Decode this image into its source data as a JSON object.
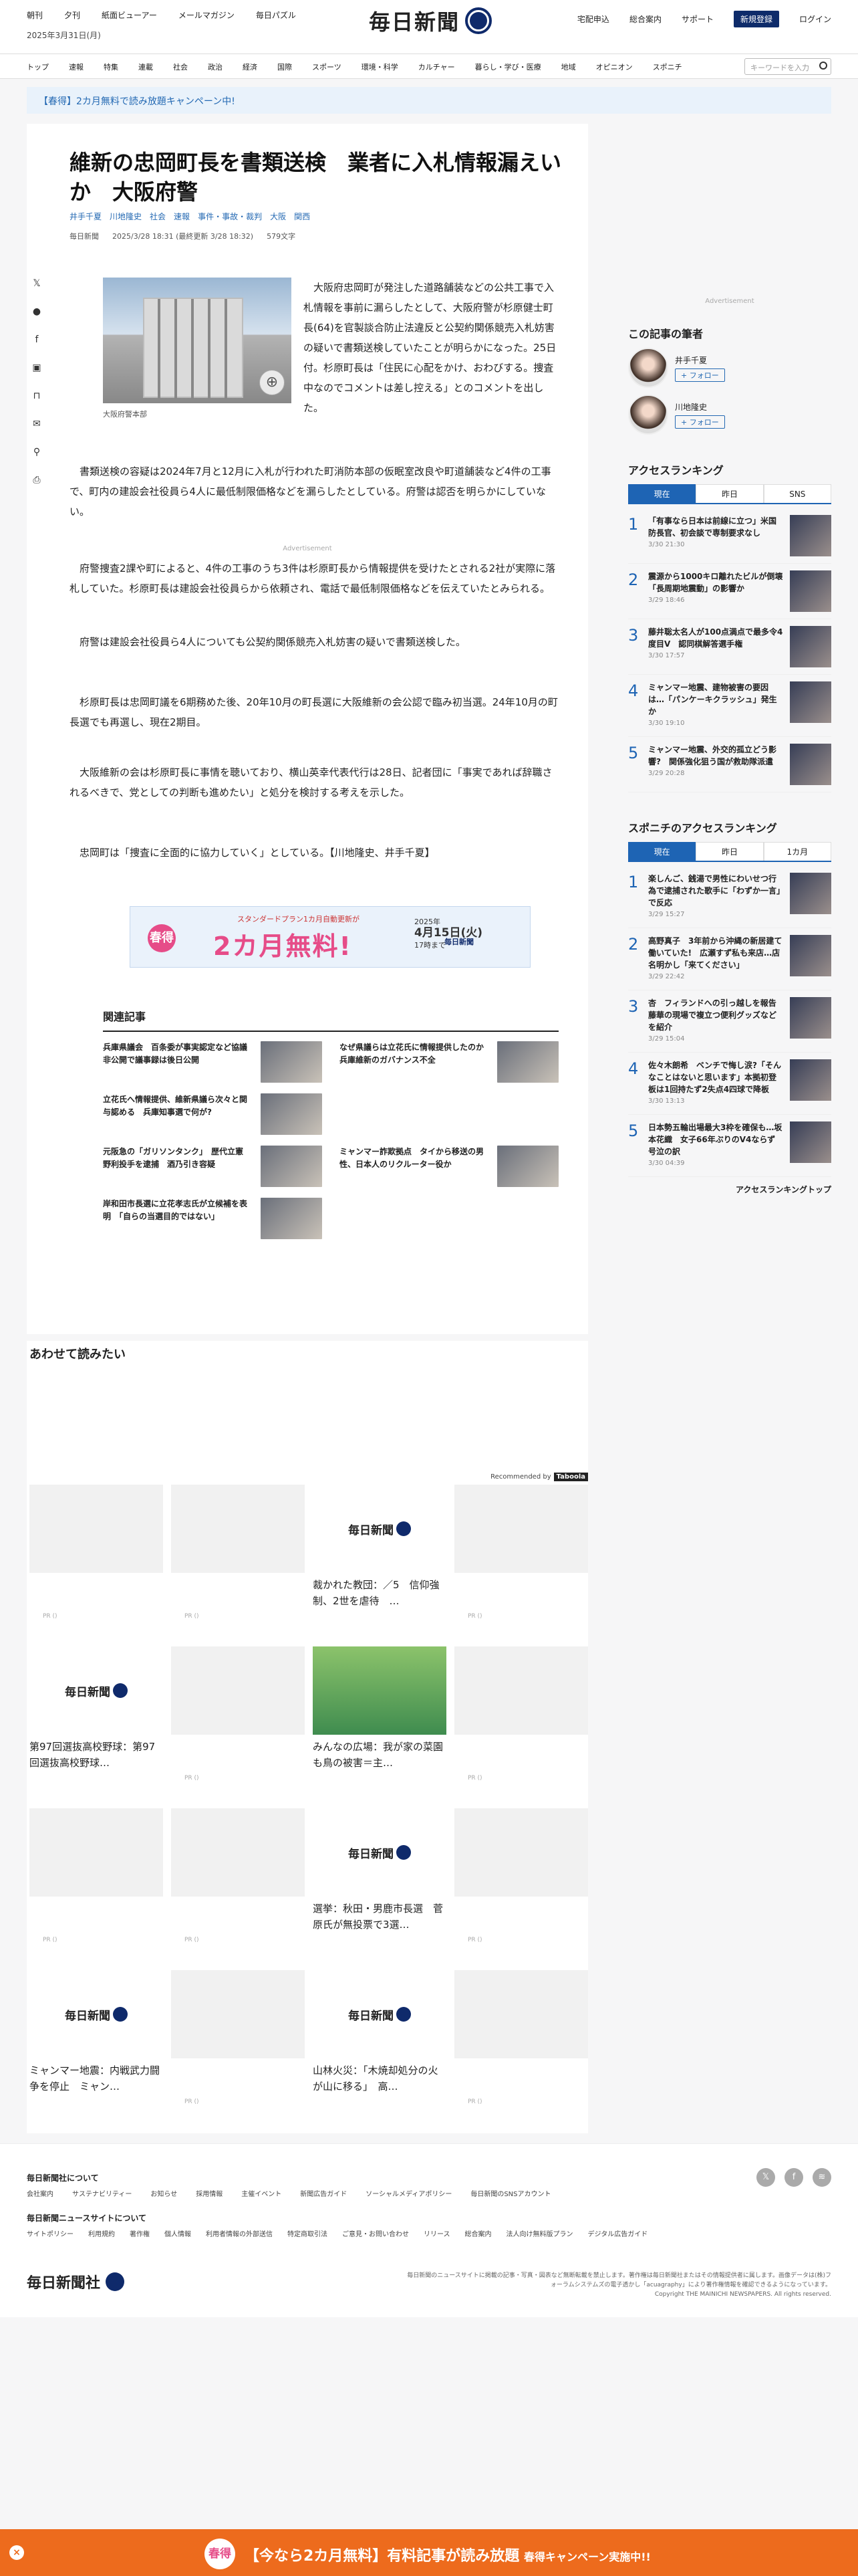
{
  "header": {
    "links": [
      "朝刊",
      "夕刊",
      "紙面ビューアー",
      "メールマガジン",
      "毎日パズル"
    ],
    "date": "2025年3月31日(月)",
    "logo": "毎日新聞",
    "right_links": [
      "宅配申込",
      "総合案内",
      "サポート"
    ],
    "register": "新規登録",
    "login": "ログイン"
  },
  "nav": {
    "items": [
      "トップ",
      "速報",
      "特集",
      "連載",
      "社会",
      "政治",
      "経済",
      "国際",
      "スポーツ",
      "環境・科学",
      "カルチャー",
      "暮らし・学び・医療",
      "地域",
      "オピニオン",
      "スポニチ"
    ],
    "search_placeholder": "キーワードを入力"
  },
  "promo": "【春得】2カ月無料で読み放題キャンペーン中!",
  "article": {
    "title": "維新の忠岡町長を書類送検　業者に入札情報漏えいか　大阪府警",
    "authors": [
      "井手千夏",
      "川地隆史"
    ],
    "tags": [
      "社会",
      "速報",
      "事件・事故・裁判",
      "大阪",
      "関西"
    ],
    "meta": [
      "毎日新聞",
      "2025/3/28 18:31 (最終更新 3/28 18:32)",
      "579文字"
    ],
    "photo_caption": "大阪府警本部",
    "lead": "大阪府忠岡町が発注した道路舗装などの公共工事で入札情報を事前に漏らしたとして、大阪府警が杉原健士町長(64)を官製談合防止法違反と公契約関係競売入札妨害の疑いで書類送検していたことが明らかになった。25日付。杉原町長は「住民に心配をかけ、おわびする。捜査中なのでコメントは差し控える」とのコメントを出した。",
    "p1": "書類送検の容疑は2024年7月と12月に入札が行われた町消防本部の仮眠室改良や町道舗装など4件の工事で、町内の建設会社役員ら4人に最低制限価格などを漏らしたとしている。府警は認否を明らかにしていない。",
    "advert": "Advertisement",
    "p2": "府警捜査2課や町によると、4件の工事のうち3件は杉原町長から情報提供を受けたとされる2社が実際に落札していた。杉原町長は建設会社役員らから依頼され、電話で最低制限価格などを伝えていたとみられる。",
    "p3": "府警は建設会社役員ら4人についても公契約関係競売入札妨害の疑いで書類送検した。",
    "p4": "杉原町長は忠岡町議を6期務めた後、20年10月の町長選に大阪維新の会公認で臨み初当選。24年10月の町長選でも再選し、現在2期目。",
    "p5": "大阪維新の会は杉原町長に事情を聴いており、横山英幸代表代行は28日、記者団に「事実であれば辞職されるべきで、党としての判断も進めたい」と処分を検討する考えを示した。",
    "p6": "忠岡町は「捜査に全面的に協力していく」としている。【川地隆史、井手千夏】"
  },
  "banner": {
    "badge": "春得",
    "t1": "スタンダードプラン1カ月自動更新が",
    "t2": "2カ月無料!",
    "t3a": "2025年",
    "t3b": "4月15日(火)",
    "t3c": "17時まで",
    "logo": "毎日新聞"
  },
  "related": {
    "title": "関連記事",
    "items": [
      "兵庫県議会　百条委が事実認定など協議　非公開で議事録は後日公開",
      "なぜ県議らは立花氏に情報提供したのか　兵庫維新のガバナンス不全",
      "立花氏へ情報提供、維新県議ら次々と関与認める　兵庫知事選で何が?",
      "",
      "元阪急の「ガリソンタンク」　歴代立憲野利投手を逮捕　酒乃引き容疑",
      "ミャンマー詐欺拠点　タイから移送の男性、日本人のリクルーター役か",
      "岸和田市長選に立花孝志氏が立候補を表明　「自らの当選目的ではない」",
      ""
    ]
  },
  "sidebar": {
    "authors_title": "この記事の筆者",
    "authors": [
      "井手千夏",
      "川地隆史"
    ],
    "follow": "+ フォロー",
    "ranking_title": "アクセスランキング",
    "tabs": [
      "現在",
      "昨日",
      "SNS"
    ],
    "ranking": [
      {
        "no": "1",
        "text": "「有事なら日本は前線に立つ」米国防長官、初会談で専制要求なし",
        "time": "3/30 21:30"
      },
      {
        "no": "2",
        "text": "震源から1000キロ離れたビルが倒壊　「長周期地震動」の影響か",
        "time": "3/29 18:46"
      },
      {
        "no": "3",
        "text": "藤井聡太名人が100点満点で最多令4度目V　認同棋解答選手権",
        "time": "3/30 17:57"
      },
      {
        "no": "4",
        "text": "ミャンマー地震、建物被害の要因は…「パンケーキクラッシュ」発生か",
        "time": "3/30 19:10"
      },
      {
        "no": "5",
        "text": "ミャンマー地震、外交的孤立どう影響?　関係強化狙う国が救助隊派遣",
        "time": "3/29 20:28"
      }
    ],
    "sponichi_title": "スポニチのアクセスランキング",
    "sponichi_tabs": [
      "現在",
      "昨日",
      "1カ月"
    ],
    "sponichi": [
      {
        "no": "1",
        "text": "楽しんご、銭湯で男性にわいせつ行為で逮捕された歌手に「わずか一言」で反応",
        "time": "3/29 15:27"
      },
      {
        "no": "2",
        "text": "高野真子　3年前から沖縄の新居建て働いていた!　広瀬すず私も来店…店名明かし「来てください」",
        "time": "3/29 22:42"
      },
      {
        "no": "3",
        "text": "杏　フィランドへの引っ越しを報告　藤華の現場で複立つ便利グッズなどを紹介",
        "time": "3/29 15:04"
      },
      {
        "no": "4",
        "text": "佐々木朗希　ベンチで悔し涙?「そんなことはないと思います」本拠初登板は1回持たず2失点4四球で降板",
        "time": "3/30 13:13"
      },
      {
        "no": "5",
        "text": "日本勢五輪出場最大3枠を確保も…坂本花織　女子66年ぶりのV4ならず号泣の訳",
        "time": "3/30 04:39"
      }
    ],
    "more": "アクセスランキングトップ"
  },
  "also": {
    "title": "あわせて読みたい",
    "recommended": "Recommended by",
    "recommended_brand": "Taboola",
    "cards": [
      {
        "title": "",
        "pr": "PR ()"
      },
      {
        "title": "",
        "pr": "PR ()"
      },
      {
        "title": "裁かれた教団：／5　信仰強制、2世を虐待　…",
        "pr": ""
      },
      {
        "title": "",
        "pr": "PR ()"
      },
      {
        "title": "第97回選抜高校野球：第97回選抜高校野球…",
        "pr": ""
      },
      {
        "title": "",
        "pr": "PR ()"
      },
      {
        "title": "みんなの広場：我が家の菜園も鳥の被害＝主…",
        "pr": ""
      },
      {
        "title": "",
        "pr": "PR ()"
      },
      {
        "title": "",
        "pr": "PR ()"
      },
      {
        "title": "",
        "pr": "PR ()"
      },
      {
        "title": "選挙：秋田・男鹿市長選　菅原氏が無投票で3選…",
        "pr": ""
      },
      {
        "title": "",
        "pr": "PR ()"
      },
      {
        "title": "ミャンマー地震：内戦武力闘争を停止　ミャン…",
        "pr": ""
      },
      {
        "title": "",
        "pr": "PR ()"
      },
      {
        "title": "山林火災：「木焼却処分の火が山に移る」　高…",
        "pr": ""
      },
      {
        "title": "",
        "pr": "PR ()"
      }
    ]
  },
  "footer": {
    "about_title": "毎日新聞社について",
    "about_links": [
      "会社案内",
      "サステナビリティー",
      "お知らせ",
      "採用情報",
      "主催イベント",
      "新聞広告ガイド",
      "ソーシャルメディアポリシー",
      "毎日新聞のSNSアカウント"
    ],
    "site_title": "毎日新聞ニュースサイトについて",
    "site_links": [
      "サイトポリシー",
      "利用規約",
      "著作権",
      "個人情報",
      "利用者情報の外部送信",
      "特定商取引法",
      "ご意見・お問い合わせ",
      "リリース",
      "総合案内",
      "法人向け無料版プラン",
      "デジタル広告ガイド"
    ],
    "logo": "毎日新聞社",
    "note": "毎日新聞のニュースサイトに掲載の記事・写真・図表など無断転載を禁止します。著作権は毎日新聞社またはその情報提供者に属します。画像データは(株)フォーラムシステムズの電子透かし「acuagraphy」により著作権情報を確認できるようになっています。",
    "copyright": "Copyright THE MAINICHI NEWSPAPERS. All rights reserved."
  },
  "bottom_bar": {
    "badge": "春得",
    "main": "【今なら2カ月無料】有料記事が読み放題",
    "sub": "春得キャンペーン実施中!!"
  }
}
